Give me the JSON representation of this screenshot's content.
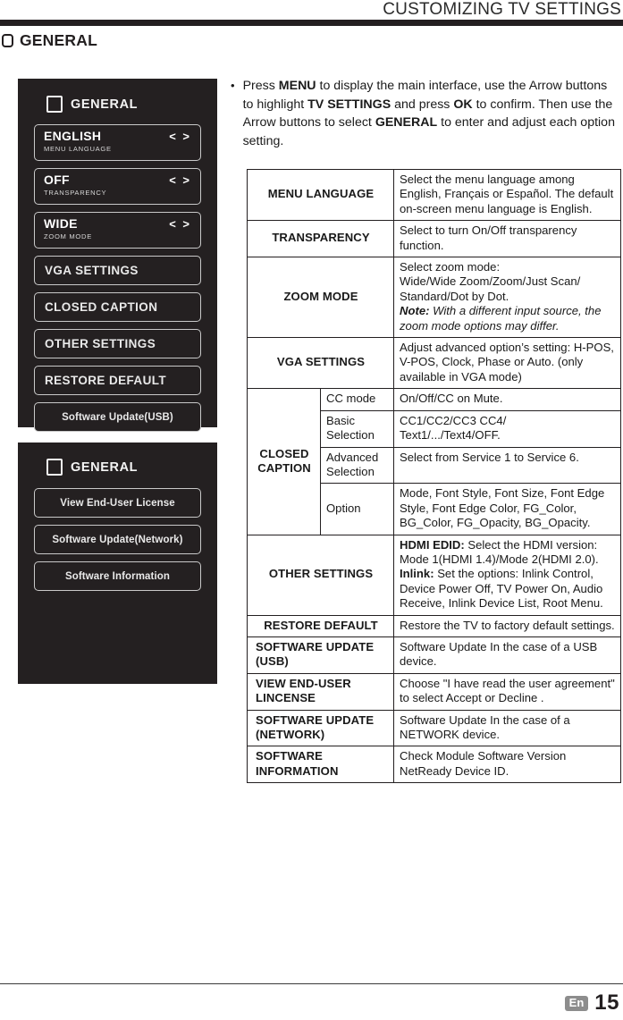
{
  "header": {
    "title": "CUSTOMIZING TV SETTINGS",
    "section_label": "GENERAL"
  },
  "osd_panel_1": {
    "title": "GENERAL",
    "items": [
      {
        "value": "ENGLISH",
        "arrows": "< >",
        "caption": "MENU LANGUAGE",
        "type": "dual"
      },
      {
        "value": "OFF",
        "arrows": "< >",
        "caption": "TRANSPARENCY",
        "type": "dual"
      },
      {
        "value": "WIDE",
        "arrows": "< >",
        "caption": "ZOOM MODE",
        "type": "dual"
      },
      {
        "label": "VGA SETTINGS",
        "type": "single"
      },
      {
        "label": "CLOSED CAPTION",
        "type": "single"
      },
      {
        "label": "OTHER SETTINGS",
        "type": "single"
      },
      {
        "label": "RESTORE DEFAULT",
        "type": "single"
      },
      {
        "label": "Software Update(USB)",
        "type": "single-small"
      }
    ]
  },
  "osd_panel_2": {
    "title": "GENERAL",
    "items": [
      {
        "label": "View End-User License"
      },
      {
        "label": "Software Update(Network)"
      },
      {
        "label": "Software Information"
      }
    ]
  },
  "instruction": {
    "bullet": "•",
    "segments": [
      {
        "text": "Press ",
        "bold": false
      },
      {
        "text": "MENU",
        "bold": true
      },
      {
        "text": " to display the main interface, use the Arrow buttons to highlight ",
        "bold": false
      },
      {
        "text": "TV SETTINGS",
        "bold": true
      },
      {
        "text": " and press ",
        "bold": false
      },
      {
        "text": "OK",
        "bold": true
      },
      {
        "text": " to confirm. Then use the Arrow buttons to select ",
        "bold": false
      },
      {
        "text": "GENERAL",
        "bold": true
      },
      {
        "text": " to enter and adjust each option setting.",
        "bold": false
      }
    ]
  },
  "table": {
    "rows": [
      {
        "name": "MENU LANGUAGE",
        "desc": "Select the menu language among English, Français or Español. The default on-screen menu language is English."
      },
      {
        "name": "TRANSPARENCY",
        "desc": "Select to turn On/Off transparency function."
      },
      {
        "name": "ZOOM MODE",
        "desc_line1": "Select zoom mode:",
        "desc_line2": "Wide/Wide Zoom/Zoom/Just Scan/",
        "desc_line3": "Standard/Dot by Dot.",
        "note_label": "Note:",
        "note_text": " With a different input source, the zoom mode options may differ."
      },
      {
        "name": "VGA SETTINGS",
        "desc": "Adjust advanced option’s setting: H-POS, V-POS, Clock, Phase or Auto. (only available in VGA mode)"
      },
      {
        "name": "CLOSED CAPTION",
        "subrows": [
          {
            "sub": "CC mode",
            "desc": "On/Off/CC on Mute."
          },
          {
            "sub": "Basic Selection",
            "desc": "CC1/CC2/CC3 CC4/\nText1/.../Text4/OFF."
          },
          {
            "sub": "Advanced Selection",
            "desc": "Select from Service 1 to Service 6."
          },
          {
            "sub": "Option",
            "desc": "Mode, Font Style, Font Size, Font Edge Style, Font Edge Color, FG_Color, BG_Color, FG_Opacity, BG_Opacity."
          }
        ]
      },
      {
        "name": "OTHER SETTINGS",
        "hdmi_label": "HDMI EDID:",
        "hdmi_text": " Select the HDMI version: Mode 1(HDMI 1.4)/Mode 2(HDMI 2.0).",
        "inlink_label": "Inlink:",
        "inlink_text": " Set the options: Inlink Control, Device Power Off, TV Power On, Audio Receive, Inlink Device List, Root Menu."
      },
      {
        "name": "RESTORE DEFAULT",
        "desc": "Restore the TV to factory default settings."
      },
      {
        "name": "SOFTWARE UPDATE (USB)",
        "desc": "Software Update In the case of a USB device."
      },
      {
        "name": "VIEW END-USER LINCENSE",
        "desc": "Choose \"I have read the user agreement\" to select Accept or Decline ."
      },
      {
        "name": "SOFTWARE UPDATE (NETWORK)",
        "desc": "Software Update In the case of a NETWORK device."
      },
      {
        "name": "SOFTWARE INFORMATION",
        "desc": "Check Module Software Version NetReady Device ID."
      }
    ]
  },
  "footer": {
    "lang": "En",
    "page": "15"
  }
}
